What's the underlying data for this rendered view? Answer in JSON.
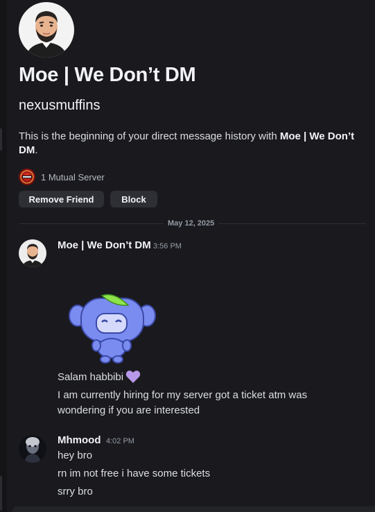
{
  "profile": {
    "display_name": "Moe | We Don’t DM",
    "username": "nexusmuffins",
    "intro_prefix": "This is the beginning of your direct message history with ",
    "intro_name": "Moe | We Don’t DM",
    "intro_suffix": ".",
    "mutual_servers": "1 Mutual Server",
    "remove_friend_label": "Remove Friend",
    "block_label": "Block"
  },
  "date_divider": "May 12, 2025",
  "messages": [
    {
      "author": "Moe | We Don’t DM",
      "time": "3:56 PM",
      "sticker": "wumpus-sticker",
      "lines": [
        "Salam habbibi",
        "I am currently hiring for my server got a ticket atm was",
        "wondering if you are interested"
      ],
      "emoji": "purple-heart"
    },
    {
      "author": "Mhmood",
      "time": "4:02 PM",
      "lines": [
        "hey bro",
        "rn im not free i have some tickets",
        "srry bro"
      ]
    }
  ],
  "colors": {
    "background": "#1a1a1e",
    "text": "#dbdee1",
    "muted": "#949ba4",
    "button": "#2e2f35"
  }
}
